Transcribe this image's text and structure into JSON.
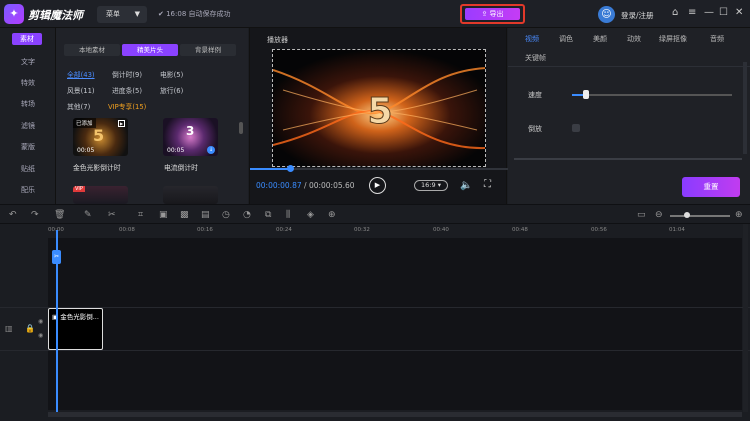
{
  "app": {
    "name": "剪辑魔法师",
    "menu_label": "菜单",
    "save_status": "16:08 自动保存成功",
    "export_label": "导出",
    "login_label": "登录/注册"
  },
  "leftnav": {
    "items": [
      "素材",
      "文字",
      "特效",
      "转场",
      "滤镜",
      "蒙版",
      "贴纸",
      "配乐"
    ]
  },
  "materials": {
    "tabs": [
      "本地素材",
      "精美片头",
      "背景样例"
    ],
    "categories": [
      "全部(43)",
      "倒计时(9)",
      "电影(5)",
      "风景(11)",
      "进度条(5)",
      "旅行(6)",
      "其他(7)",
      "VIP专享(15)"
    ],
    "items": [
      {
        "title": "金色光影倒计时",
        "duration": "00:05",
        "badge": "已添加"
      },
      {
        "title": "电流倒计时",
        "duration": "00:05"
      }
    ]
  },
  "player": {
    "title": "播放器",
    "current_time": "00:00:00.87",
    "total_time": "00:00:05.60",
    "ratio": "16:9",
    "progress": 0.155
  },
  "props": {
    "tabs": [
      "视频",
      "调色",
      "美颜",
      "动效",
      "绿屏抠像",
      "音频"
    ],
    "tab2": "关键帧",
    "speed_label": "速度",
    "reverse_label": "倒放",
    "reset_label": "重置",
    "speed_value": 0.08
  },
  "timeline": {
    "ticks": [
      "00:00",
      "00:08",
      "00:16",
      "00:24",
      "00:32",
      "00:40",
      "00:48",
      "00:56",
      "01:04"
    ],
    "clip_label": "金色光影倒..."
  },
  "colors": {
    "accent": "#8a42ff",
    "blue": "#3a8cff",
    "highlight": "#e2392a"
  }
}
